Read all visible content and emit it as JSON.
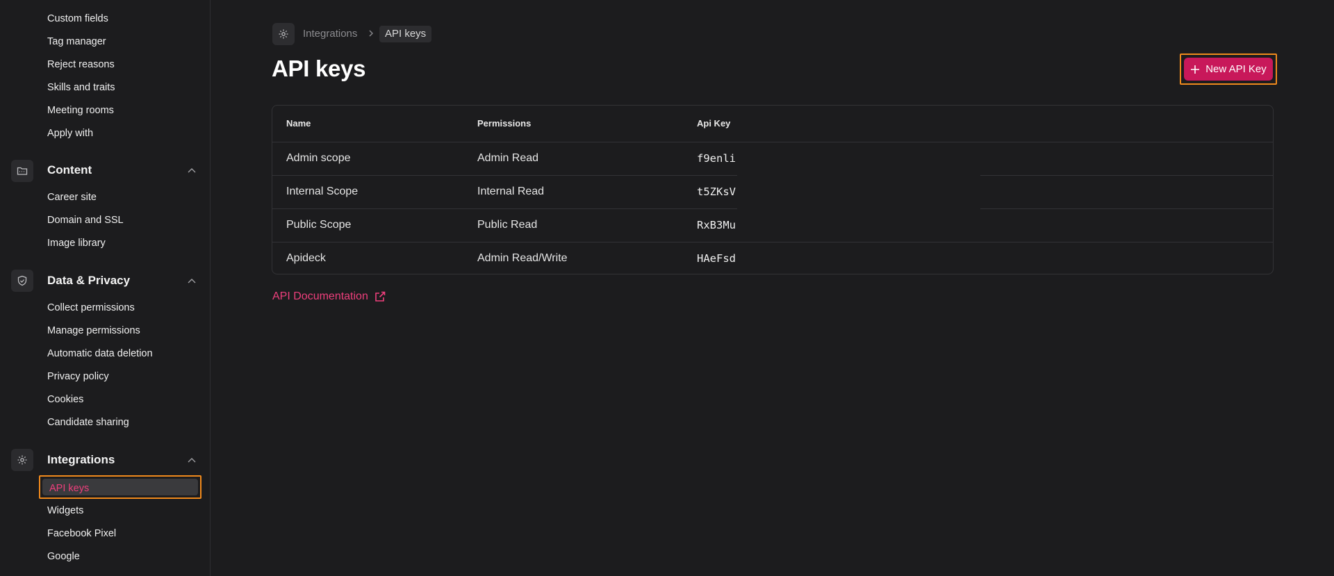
{
  "sidebar": {
    "top_items": [
      {
        "label": "Custom fields"
      },
      {
        "label": "Tag manager"
      },
      {
        "label": "Reject reasons"
      },
      {
        "label": "Skills and traits"
      },
      {
        "label": "Meeting rooms"
      },
      {
        "label": "Apply with"
      }
    ],
    "sections": [
      {
        "title": "Content",
        "icon": "folder-icon",
        "items": [
          {
            "label": "Career site"
          },
          {
            "label": "Domain and SSL"
          },
          {
            "label": "Image library"
          }
        ]
      },
      {
        "title": "Data & Privacy",
        "icon": "shield-check-icon",
        "items": [
          {
            "label": "Collect permissions"
          },
          {
            "label": "Manage permissions"
          },
          {
            "label": "Automatic data deletion"
          },
          {
            "label": "Privacy policy"
          },
          {
            "label": "Cookies"
          },
          {
            "label": "Candidate sharing"
          }
        ]
      },
      {
        "title": "Integrations",
        "icon": "gear-icon",
        "items": [
          {
            "label": "API keys",
            "active": true
          },
          {
            "label": "Widgets"
          },
          {
            "label": "Facebook Pixel"
          },
          {
            "label": "Google"
          }
        ]
      }
    ]
  },
  "breadcrumb": {
    "icon": "gear-icon",
    "parent": "Integrations",
    "current": "API keys"
  },
  "page": {
    "title": "API keys",
    "new_button_label": "New API Key"
  },
  "table": {
    "headers": [
      "Name",
      "Permissions",
      "Api Key"
    ],
    "rows": [
      {
        "name": "Admin scope",
        "permissions": "Admin Read",
        "key": "f9enli"
      },
      {
        "name": "Internal Scope",
        "permissions": "Internal Read",
        "key": "t5ZKsV"
      },
      {
        "name": "Public Scope",
        "permissions": "Public Read",
        "key": "RxB3Mu"
      },
      {
        "name": "Apideck",
        "permissions": "Admin Read/Write",
        "key": "HAeFsd"
      }
    ]
  },
  "doc_link": {
    "label": "API Documentation",
    "icon": "external-link-icon"
  },
  "colors": {
    "background": "#1c1c1e",
    "accent": "#ee3f7c",
    "button": "#c8185a",
    "highlight": "#f18a1c"
  }
}
